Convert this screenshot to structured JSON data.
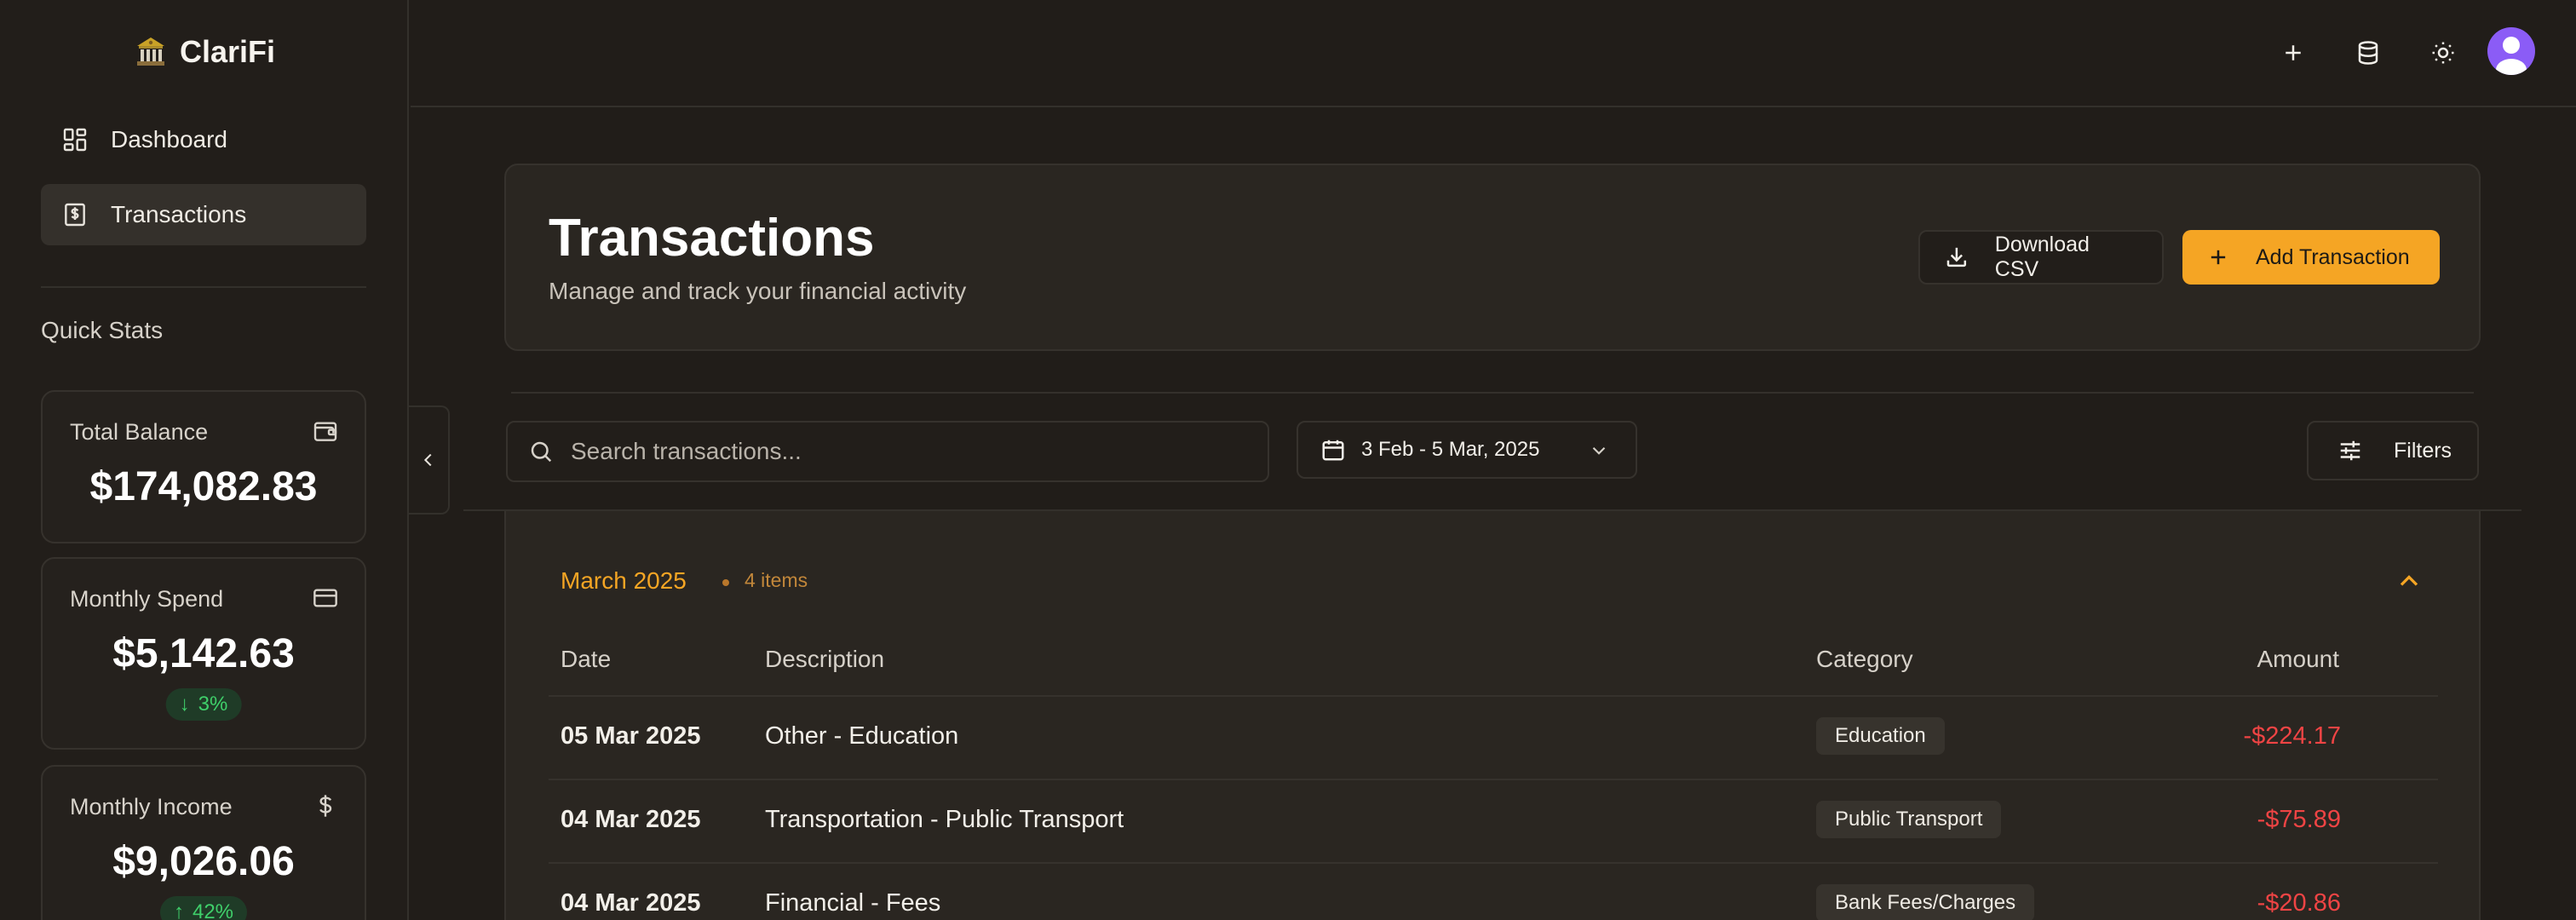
{
  "app": {
    "name": "ClariFi",
    "logo_icon": "bank-icon"
  },
  "sidebar": {
    "items": [
      {
        "label": "Dashboard",
        "icon": "dashboard-icon",
        "active": false
      },
      {
        "label": "Transactions",
        "icon": "receipt-dollar-icon",
        "active": true
      }
    ],
    "quick_stats_title": "Quick Stats",
    "stats": [
      {
        "label": "Total Balance",
        "value": "$174,082.83",
        "icon": "wallet-icon"
      },
      {
        "label": "Monthly Spend",
        "value": "$5,142.63",
        "icon": "credit-card-icon",
        "change": "3%",
        "direction": "down"
      },
      {
        "label": "Monthly Income",
        "value": "$9,026.06",
        "icon": "dollar-icon",
        "change": "42%",
        "direction": "up"
      }
    ]
  },
  "topbar": {
    "icons": [
      "plus-icon",
      "database-icon",
      "sun-icon"
    ],
    "avatar_color": "#8b5cf6"
  },
  "header": {
    "title": "Transactions",
    "subtitle": "Manage and track your financial activity",
    "download_label": "Download CSV",
    "add_label": "Add Transaction"
  },
  "toolbar": {
    "search_placeholder": "Search transactions...",
    "date_range": "3 Feb - 5 Mar, 2025",
    "filters_label": "Filters"
  },
  "group": {
    "title": "March 2025",
    "count": "4 items",
    "columns": {
      "date": "Date",
      "description": "Description",
      "category": "Category",
      "amount": "Amount"
    },
    "rows": [
      {
        "date": "05 Mar 2025",
        "description": "Other - Education",
        "category": "Education",
        "amount": "-$224.17"
      },
      {
        "date": "04 Mar 2025",
        "description": "Transportation - Public Transport",
        "category": "Public Transport",
        "amount": "-$75.89"
      },
      {
        "date": "04 Mar 2025",
        "description": "Financial - Fees",
        "category": "Bank Fees/Charges",
        "amount": "-$20.86"
      }
    ]
  },
  "colors": {
    "accent": "#f5a524",
    "negative": "#ef4444",
    "positive": "#3fcf6a",
    "background": "#211d19"
  }
}
